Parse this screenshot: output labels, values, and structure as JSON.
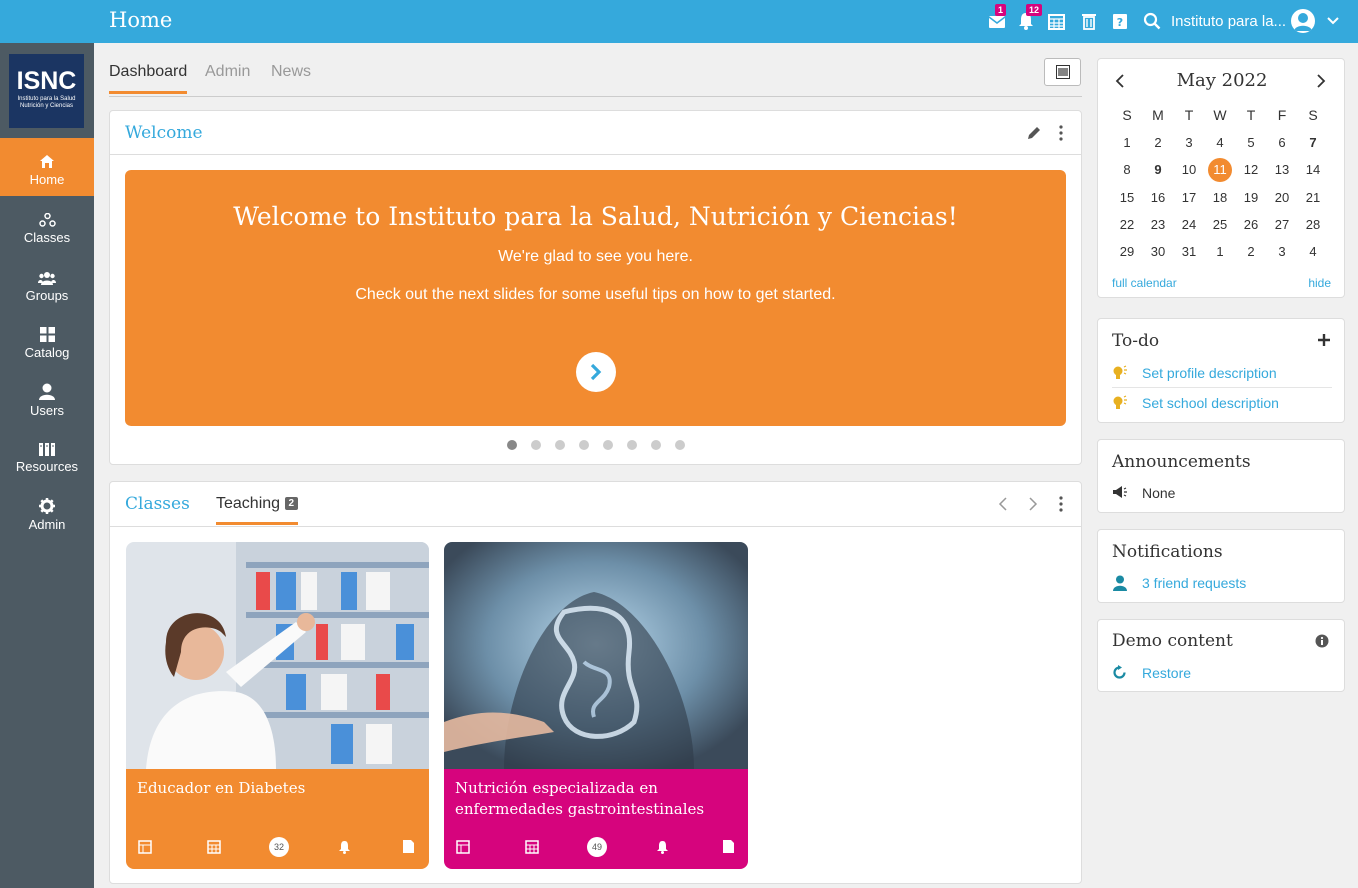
{
  "header": {
    "title": "Home",
    "messages_badge": "1",
    "notifications_badge": "12",
    "school_name": "Instituto para la..."
  },
  "logo": {
    "big": "ISNC",
    "small": "Instituto para la Salud Nutrición y Ciencias"
  },
  "sidebar": {
    "items": [
      {
        "label": "Home",
        "icon": "home-icon"
      },
      {
        "label": "Classes",
        "icon": "classes-icon"
      },
      {
        "label": "Groups",
        "icon": "groups-icon"
      },
      {
        "label": "Catalog",
        "icon": "catalog-icon"
      },
      {
        "label": "Users",
        "icon": "users-icon"
      },
      {
        "label": "Resources",
        "icon": "resources-icon"
      },
      {
        "label": "Admin",
        "icon": "gear-icon"
      }
    ]
  },
  "tabs": [
    "Dashboard",
    "Admin",
    "News"
  ],
  "welcome": {
    "title": "Welcome",
    "headline": "Welcome to Instituto para la Salud, Nutrición y Ciencias!",
    "line1": "We're glad to see you here.",
    "line2": "Check out the next slides for some useful tips on how to get started."
  },
  "classes": {
    "title": "Classes",
    "teaching_label": "Teaching",
    "teaching_count": "2",
    "cards": [
      {
        "name": "Educador en Diabetes",
        "count": "32",
        "color": "#f28b30"
      },
      {
        "name": "Nutrición especializada en enfermedades gastrointestinales",
        "count": "49",
        "color": "#d6047d"
      }
    ]
  },
  "calendar": {
    "month": "May 2022",
    "weekdays": [
      "S",
      "M",
      "T",
      "W",
      "T",
      "F",
      "S"
    ],
    "weeks": [
      [
        "1",
        "2",
        "3",
        "4",
        "5",
        "6",
        "7"
      ],
      [
        "8",
        "9",
        "10",
        "11",
        "12",
        "13",
        "14"
      ],
      [
        "15",
        "16",
        "17",
        "18",
        "19",
        "20",
        "21"
      ],
      [
        "22",
        "23",
        "24",
        "25",
        "26",
        "27",
        "28"
      ],
      [
        "29",
        "30",
        "31",
        "1",
        "2",
        "3",
        "4"
      ]
    ],
    "full_calendar": "full calendar",
    "hide": "hide"
  },
  "todo": {
    "title": "To-do",
    "items": [
      "Set profile description",
      "Set school description"
    ]
  },
  "announcements": {
    "title": "Announcements",
    "text": "None"
  },
  "notifications": {
    "title": "Notifications",
    "text": "3 friend requests"
  },
  "demo": {
    "title": "Demo content",
    "text": "Restore"
  },
  "colors": {
    "accent": "#35a9dc",
    "orange": "#f28b30",
    "pink": "#d6047d",
    "sidebar": "#4d5a63"
  }
}
